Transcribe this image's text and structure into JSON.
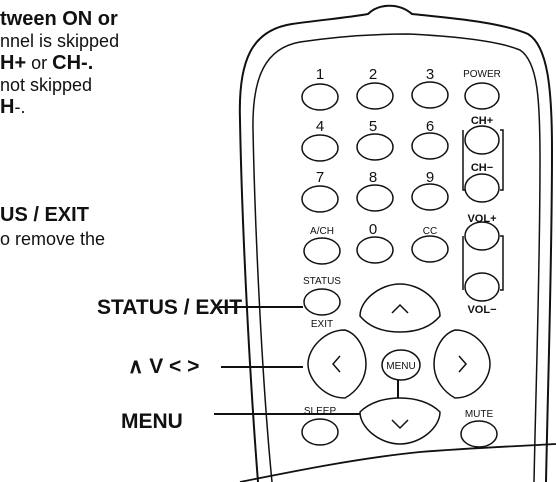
{
  "text_lines": [
    {
      "a": "tween ",
      "b": "ON or",
      "c": ""
    },
    {
      "a": "nnel is skipped",
      "b": "",
      "c": ""
    },
    {
      "a": "",
      "b": "H+",
      "c": " or "
    },
    {
      "b2": "CH-."
    },
    {
      "a": " not skipped"
    },
    {
      "b": "H",
      "c": "-."
    },
    {
      "b": "US / EXIT"
    },
    {
      "a": "o remove the"
    }
  ],
  "callouts": {
    "status_exit": "STATUS / EXIT",
    "arrows": "∧ V < >",
    "menu": "MENU"
  },
  "remote": {
    "num1": "1",
    "num2": "2",
    "num3": "3",
    "num4": "4",
    "num5": "5",
    "num6": "6",
    "num7": "7",
    "num8": "8",
    "num9": "9",
    "num0": "0",
    "power": "POWER",
    "ach": "A/CH",
    "cc": "CC",
    "ch_plus": "CH+",
    "ch_minus": "CH−",
    "vol_plus": "VOL+",
    "vol_minus": "VOL−",
    "status": "STATUS",
    "exit": "EXIT",
    "menu": "MENU",
    "sleep": "SLEEP",
    "mute": "MUTE"
  }
}
